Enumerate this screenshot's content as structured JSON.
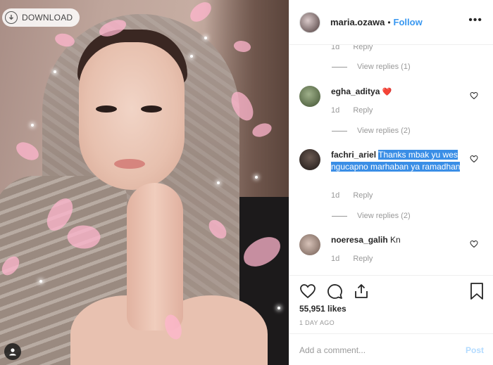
{
  "photo": {
    "download_label": "DOWNLOAD"
  },
  "post": {
    "username": "maria.ozawa",
    "separator": "•",
    "follow_label": "Follow",
    "more_label": "•••"
  },
  "comments": [
    {
      "username": "",
      "text": "",
      "time": "1d",
      "reply_label": "Reply",
      "view_replies": "View replies (1)"
    },
    {
      "username": "egha_aditya",
      "text": "",
      "emoji": "❤️",
      "time": "1d",
      "reply_label": "Reply",
      "view_replies": "View replies (2)"
    },
    {
      "username": "fachri_ariel",
      "text": "Thanks mbak yu wes ngucapno marhaban ya ramadhan",
      "time": "1d",
      "reply_label": "Reply",
      "view_replies": "View replies (2)"
    },
    {
      "username": "noeresa_galih",
      "text": "Kn",
      "time": "1d",
      "reply_label": "Reply"
    }
  ],
  "actions": {
    "likes": "55,951 likes",
    "time_ago": "1 DAY AGO",
    "comment_placeholder": "Add a comment...",
    "post_label": "Post"
  },
  "colors": {
    "accent": "#3897f0",
    "highlight": "#3a8ee6",
    "muted": "#999999",
    "text": "#262626"
  }
}
